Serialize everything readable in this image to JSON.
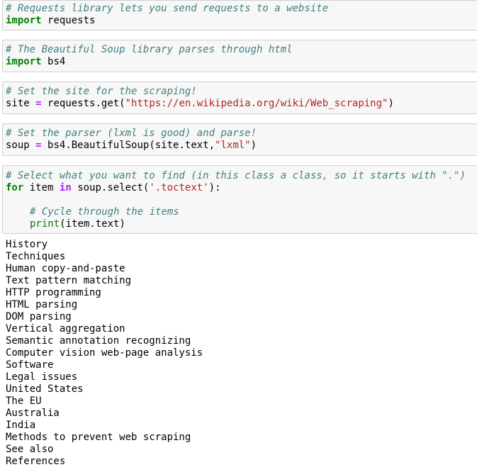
{
  "cells": [
    {
      "comment": "# Requests library lets you send requests to a website",
      "keyword": "import",
      "module": "requests"
    },
    {
      "comment": "# The Beautiful Soup library parses through html",
      "keyword": "import",
      "module": "bs4"
    },
    {
      "comment": "# Set the site for the scraping!",
      "var": "site",
      "op": "=",
      "call": "requests.get(",
      "string": "\"https://en.wikipedia.org/wiki/Web_scraping\"",
      "close": ")"
    },
    {
      "comment": "# Set the parser (lxml is good) and parse!",
      "var": "soup",
      "op": "=",
      "call": "bs4.BeautifulSoup(site.text,",
      "string": "\"lxml\"",
      "close": ")"
    },
    {
      "comment": "# Select what you want to find (in this class a class, so it starts with \".\")",
      "for_kw": "for",
      "loop_var": "item",
      "in_kw": "in",
      "call": "soup.select(",
      "string": "'.toctext'",
      "close": "):",
      "inner_comment": "# Cycle through the items",
      "print_fn": "print",
      "print_args": "(item.text)"
    }
  ],
  "output": [
    "History",
    "Techniques",
    "Human copy-and-paste",
    "Text pattern matching",
    "HTTP programming",
    "HTML parsing",
    "DOM parsing",
    "Vertical aggregation",
    "Semantic annotation recognizing",
    "Computer vision web-page analysis",
    "Software",
    "Legal issues",
    "United States",
    "The EU",
    "Australia",
    "India",
    "Methods to prevent web scraping",
    "See also",
    "References"
  ]
}
